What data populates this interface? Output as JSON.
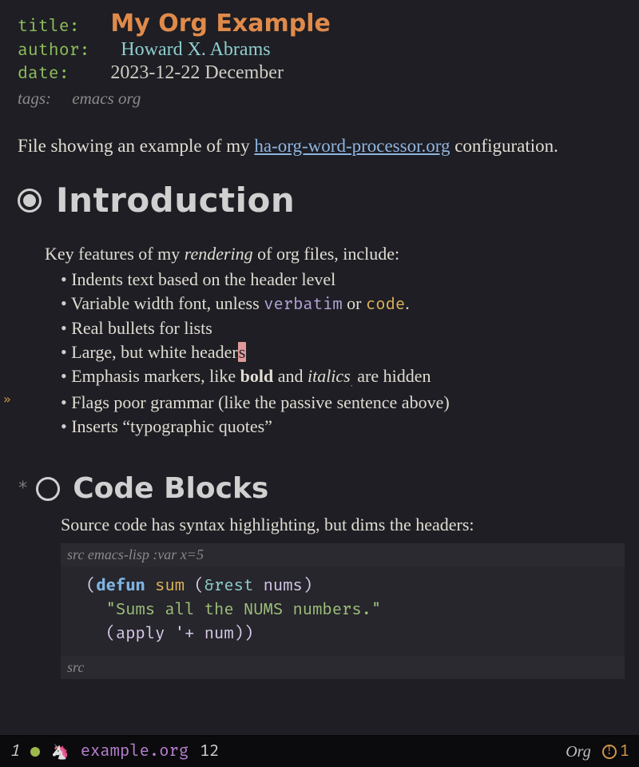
{
  "meta": {
    "title_key": "title:",
    "title_val": "My Org Example",
    "author_key": "author:",
    "author_val": "Howard X. Abrams",
    "date_key": "date:",
    "date_val": "2023-12-22 December",
    "tags_key": "tags:",
    "tags_val": "emacs org"
  },
  "intro_para_pre": "File showing an example of my ",
  "intro_link": "ha-org-word-processor.org",
  "intro_para_post": " configuration.",
  "h1": "Introduction",
  "body_lead_pre": "Key features of my ",
  "body_lead_em": "rendering",
  "body_lead_post": " of org files, include:",
  "bullets": {
    "b0": "Indents text based on the header level",
    "b1_pre": "Variable width font, unless ",
    "b1_verb": "verbatim",
    "b1_mid": " or ",
    "b1_code": "code",
    "b1_post": ".",
    "b2": "Real bullets for lists",
    "b3_pre": "Large, but white header",
    "b3_cursor": "s",
    "b4_pre": "Emphasis markers, like ",
    "b4_bold": "bold",
    "b4_mid": " and ",
    "b4_ital": "italics",
    "b4_post": " are hidden",
    "b5": "Flags poor grammar (like the passive sentence above)",
    "b6": "Inserts “typographic quotes”"
  },
  "h2": "Code Blocks",
  "src_intro": "Source code has syntax highlighting, but dims the headers:",
  "src_header_pre": "src ",
  "src_header_lang": "emacs-lisp :var x=5",
  "src_footer": "src",
  "code": {
    "l1_open": "(",
    "l1_defun": "defun",
    "l1_sp1": " ",
    "l1_fn": "sum",
    "l1_sp2": " (",
    "l1_amp": "&rest",
    "l1_sp3": " ",
    "l1_arg": "nums",
    "l1_close": ")",
    "l2_indent": "  ",
    "l2_str": "\"Sums all the NUMS numbers.\"",
    "l3_indent": "  ",
    "l3_open": "(",
    "l3_apply": "apply ",
    "l3_quote": "'",
    "l3_plus": "+ ",
    "l3_num": "num",
    "l3_close": "))"
  },
  "modeline": {
    "winnum": "1",
    "filename": "example.org",
    "percent": "12",
    "mode": "Org",
    "warn_count": "1"
  }
}
